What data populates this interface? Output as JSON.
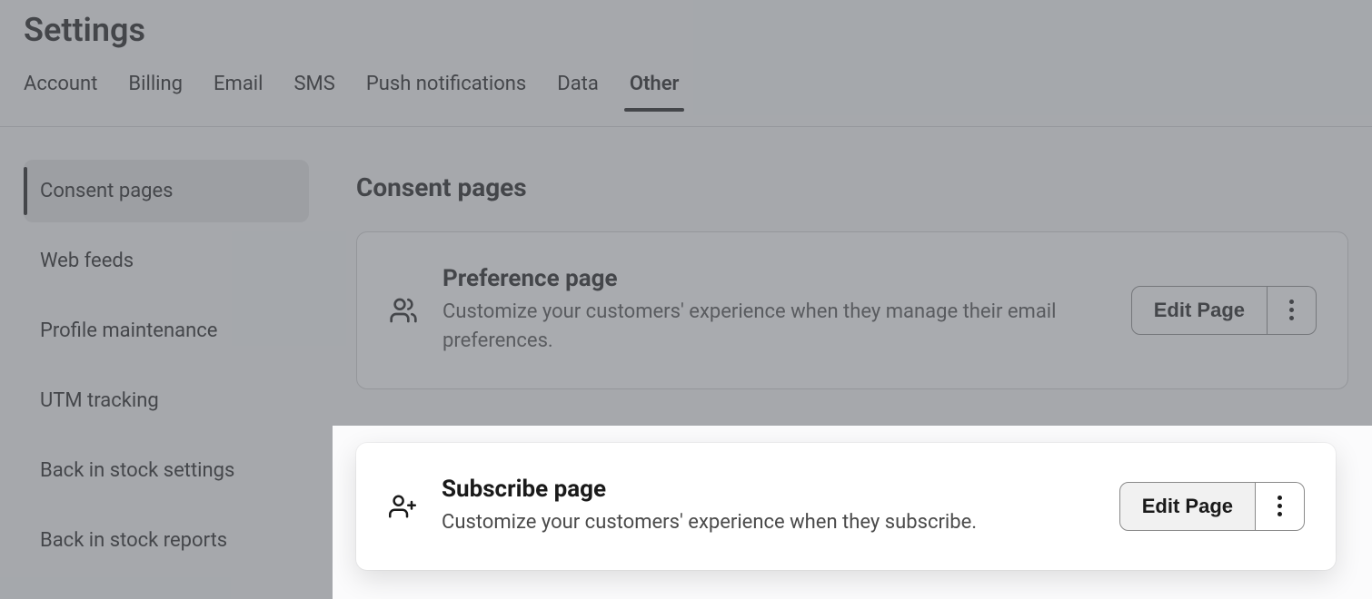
{
  "page_title": "Settings",
  "tabs": [
    {
      "label": "Account",
      "active": false
    },
    {
      "label": "Billing",
      "active": false
    },
    {
      "label": "Email",
      "active": false
    },
    {
      "label": "SMS",
      "active": false
    },
    {
      "label": "Push notifications",
      "active": false
    },
    {
      "label": "Data",
      "active": false
    },
    {
      "label": "Other",
      "active": true
    }
  ],
  "sidebar": {
    "items": [
      {
        "label": "Consent pages",
        "active": true
      },
      {
        "label": "Web feeds",
        "active": false
      },
      {
        "label": "Profile maintenance",
        "active": false
      },
      {
        "label": "UTM tracking",
        "active": false
      },
      {
        "label": "Back in stock settings",
        "active": false
      },
      {
        "label": "Back in stock reports",
        "active": false
      }
    ]
  },
  "main": {
    "section_title": "Consent pages",
    "cards": [
      {
        "icon": "people-icon",
        "title": "Preference page",
        "desc": "Customize your customers' experience when they manage their email preferences.",
        "action_label": "Edit Page"
      },
      {
        "icon": "person-add-icon",
        "title": "Subscribe page",
        "desc": "Customize your customers' experience when they subscribe.",
        "action_label": "Edit Page"
      }
    ]
  }
}
